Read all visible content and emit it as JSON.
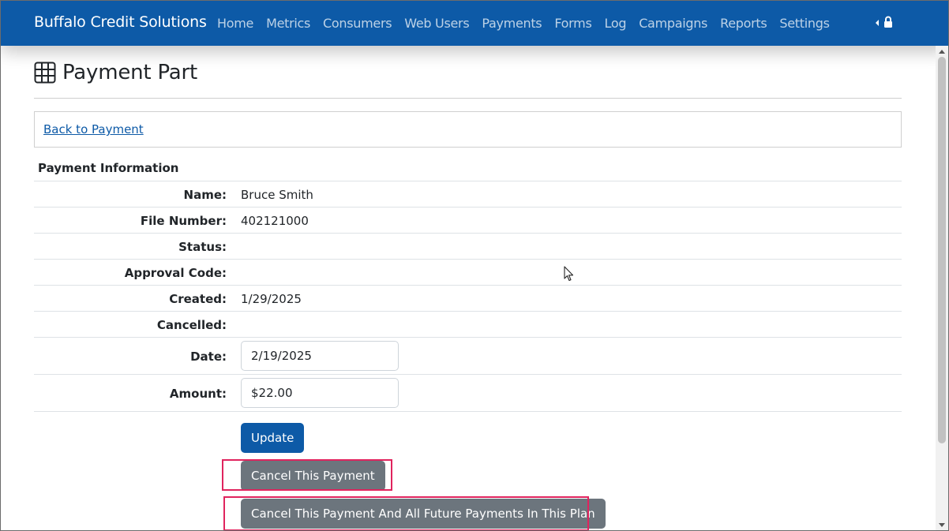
{
  "navbar": {
    "brand": "Buffalo Credit Solutions",
    "links": [
      "Home",
      "Metrics",
      "Consumers",
      "Web Users",
      "Payments",
      "Forms",
      "Log",
      "Campaigns",
      "Reports",
      "Settings"
    ],
    "icons": [
      "caret-left-icon",
      "lock-icon"
    ]
  },
  "page": {
    "title": "Payment Part",
    "title_icon": "table-grid-icon",
    "back_link": "Back to Payment"
  },
  "payment_info": {
    "section_title": "Payment Information",
    "name_label": "Name:",
    "name_value": "Bruce Smith",
    "file_number_label": "File Number:",
    "file_number_value": "402121000",
    "status_label": "Status:",
    "status_value": "",
    "approval_code_label": "Approval Code:",
    "approval_code_value": "",
    "created_label": "Created:",
    "created_value": "1/29/2025",
    "cancelled_label": "Cancelled:",
    "cancelled_value": "",
    "date_label": "Date:",
    "date_value": "2/19/2025",
    "amount_label": "Amount:",
    "amount_value": "$22.00"
  },
  "actions": {
    "update_label": "Update",
    "cancel_payment_label": "Cancel This Payment",
    "cancel_all_label": "Cancel This Payment And All Future Payments In This Plan"
  },
  "colors": {
    "navbar": "#0d5aa7",
    "primary": "#0d5aa7",
    "secondary": "#6c757d",
    "highlight": "#e0245e"
  }
}
